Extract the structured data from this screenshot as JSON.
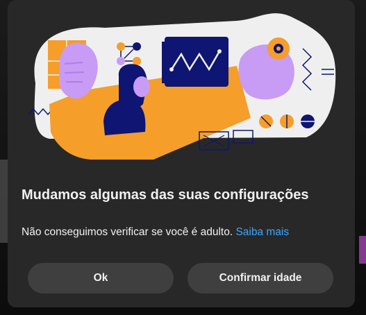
{
  "dialog": {
    "title": "Mudamos algumas das suas configurações",
    "message": "Não conseguimos verificar se você é adulto.",
    "learn_more_link": "Saiba mais",
    "ok_button": "Ok",
    "confirm_age_button": "Confirmar idade"
  },
  "colors": {
    "dialog_bg": "#282828",
    "button_bg": "#3f3f3f",
    "link": "#3ea6ff",
    "text": "#f1f1f1",
    "illustration_orange": "#f59e2a",
    "illustration_purple": "#c89bf5",
    "illustration_navy": "#0f1572"
  },
  "illustration": {
    "icon": "settings-change-illustration"
  }
}
